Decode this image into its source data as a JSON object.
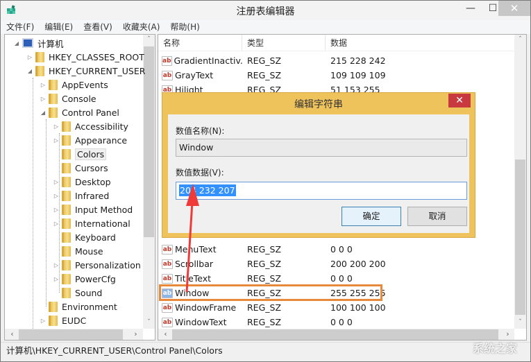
{
  "window": {
    "title": "注册表编辑器",
    "app_icon": "regedit-icon",
    "controls": {
      "minimize": "—",
      "maximize": "☐",
      "close": "✕"
    }
  },
  "menu": [
    "文件(F)",
    "编辑(E)",
    "查看(V)",
    "收藏夹(A)",
    "帮助(H)"
  ],
  "tree": {
    "root": "计算机",
    "items": [
      {
        "label": "计算机",
        "level": 0,
        "expander": "◢",
        "icon": "computer-icon"
      },
      {
        "label": "HKEY_CLASSES_ROOT",
        "level": 1,
        "expander": "▷",
        "icon": "folder-icon"
      },
      {
        "label": "HKEY_CURRENT_USER",
        "level": 1,
        "expander": "◢",
        "icon": "folder-icon"
      },
      {
        "label": "AppEvents",
        "level": 2,
        "expander": "▷",
        "icon": "folder-icon"
      },
      {
        "label": "Console",
        "level": 2,
        "expander": "▷",
        "icon": "folder-icon"
      },
      {
        "label": "Control Panel",
        "level": 2,
        "expander": "◢",
        "icon": "folder-icon"
      },
      {
        "label": "Accessibility",
        "level": 3,
        "expander": "▷",
        "icon": "folder-icon"
      },
      {
        "label": "Appearance",
        "level": 3,
        "expander": "▷",
        "icon": "folder-icon"
      },
      {
        "label": "Colors",
        "level": 3,
        "expander": "",
        "icon": "folder-icon",
        "selected": true
      },
      {
        "label": "Cursors",
        "level": 3,
        "expander": "",
        "icon": "folder-icon"
      },
      {
        "label": "Desktop",
        "level": 3,
        "expander": "▷",
        "icon": "folder-icon"
      },
      {
        "label": "Infrared",
        "level": 3,
        "expander": "▷",
        "icon": "folder-icon"
      },
      {
        "label": "Input Method",
        "level": 3,
        "expander": "▷",
        "icon": "folder-icon"
      },
      {
        "label": "International",
        "level": 3,
        "expander": "▷",
        "icon": "folder-icon"
      },
      {
        "label": "Keyboard",
        "level": 3,
        "expander": "",
        "icon": "folder-icon"
      },
      {
        "label": "Mouse",
        "level": 3,
        "expander": "",
        "icon": "folder-icon"
      },
      {
        "label": "Personalization",
        "level": 3,
        "expander": "▷",
        "icon": "folder-icon"
      },
      {
        "label": "PowerCfg",
        "level": 3,
        "expander": "▷",
        "icon": "folder-icon"
      },
      {
        "label": "Sound",
        "level": 3,
        "expander": "",
        "icon": "folder-icon"
      },
      {
        "label": "Environment",
        "level": 2,
        "expander": "",
        "icon": "folder-icon"
      },
      {
        "label": "EUDC",
        "level": 2,
        "expander": "▷",
        "icon": "folder-icon"
      }
    ]
  },
  "list": {
    "columns": [
      "名称",
      "类型",
      "数据"
    ],
    "rows_top": [
      {
        "name": "GradientInactiv...",
        "type": "REG_SZ",
        "data": "215 228 242"
      },
      {
        "name": "GrayText",
        "type": "REG_SZ",
        "data": "109 109 109"
      },
      {
        "name": "Hilight",
        "type": "REG_SZ",
        "data": "51 153 255"
      }
    ],
    "rows_bottom": [
      {
        "name": "MenuText",
        "type": "REG_SZ",
        "data": "0 0 0"
      },
      {
        "name": "Scrollbar",
        "type": "REG_SZ",
        "data": "200 200 200"
      },
      {
        "name": "TitleText",
        "type": "REG_SZ",
        "data": "0 0 0"
      },
      {
        "name": "Window",
        "type": "REG_SZ",
        "data": "255 255 255",
        "selected": true
      },
      {
        "name": "WindowFrame",
        "type": "REG_SZ",
        "data": "100 100 100"
      },
      {
        "name": "WindowText",
        "type": "REG_SZ",
        "data": "0 0 0"
      }
    ],
    "value_icon_text": "ab"
  },
  "dialog": {
    "title": "编辑字符串",
    "close": "✕",
    "name_label": "数值名称(N):",
    "name_value": "Window",
    "data_label": "数值数据(V):",
    "data_value": "204 232 207",
    "ok": "确定",
    "cancel": "取消"
  },
  "status": {
    "path": "计算机\\HKEY_CURRENT_USER\\Control Panel\\Colors"
  },
  "scroll": {
    "up": "ˆ",
    "down": "ˇ",
    "left": "‹",
    "right": "›"
  },
  "annotation": {
    "highlight_color": "#e8883a",
    "arrow_color": "#f03a3a"
  },
  "watermark": "系统之家"
}
